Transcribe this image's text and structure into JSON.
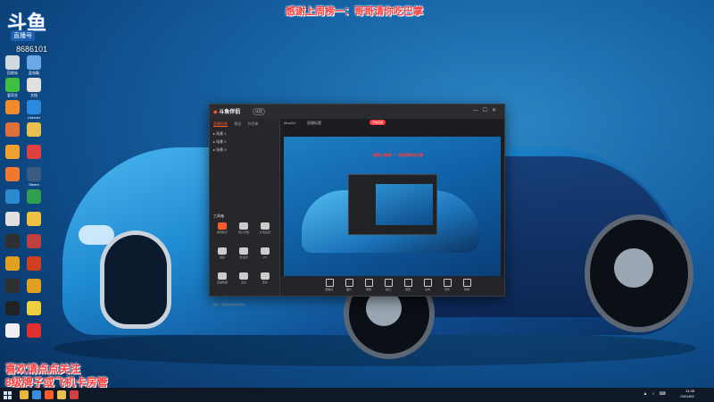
{
  "overlay": {
    "top_banner": "感谢上周榜一：哥哥请你吃巴掌",
    "bottom_line1": "喜欢请点点关注",
    "bottom_line2": "8级牌子或飞机卡房管",
    "logo_text": "斗鱼",
    "logo_sub": "直播号",
    "room_number": "8686101"
  },
  "desktop_icons": [
    {
      "name": "recycle-bin-icon",
      "label": "回收站",
      "color": "#d0d8e0"
    },
    {
      "name": "computer-icon",
      "label": "此电脑",
      "color": "#6aa8e8"
    },
    {
      "name": "iqiyi-icon",
      "label": "爱奇艺",
      "color": "#3fbf3f"
    },
    {
      "name": "doc-icon",
      "label": "文档",
      "color": "#e0e0e0"
    },
    {
      "name": "orange-app-icon",
      "label": "",
      "color": "#f08a2a"
    },
    {
      "name": "ie-icon",
      "label": "Internet",
      "color": "#2a8ae0"
    },
    {
      "name": "app-icon-2",
      "label": "",
      "color": "#e0703a"
    },
    {
      "name": "folder-icon",
      "label": "",
      "color": "#e8c050"
    },
    {
      "name": "app-icon-3",
      "label": "",
      "color": "#f0a030"
    },
    {
      "name": "chrome-icon",
      "label": "",
      "color": "#e04040"
    },
    {
      "name": "app-icon-4",
      "label": "",
      "color": "#f07830"
    },
    {
      "name": "steam-icon",
      "label": "Steam",
      "color": "#3a5a80"
    },
    {
      "name": "edge-icon",
      "label": "",
      "color": "#2a8ad0"
    },
    {
      "name": "app-icon-5",
      "label": "",
      "color": "#30a050"
    },
    {
      "name": "app-icon-6",
      "label": "",
      "color": "#e0e0e0"
    },
    {
      "name": "app-icon-7",
      "label": "",
      "color": "#f0c040"
    },
    {
      "name": "app-icon-8",
      "label": "",
      "color": "#303030"
    },
    {
      "name": "app-icon-9",
      "label": "",
      "color": "#c04040"
    },
    {
      "name": "app-icon-10",
      "label": "",
      "color": "#e0a020"
    },
    {
      "name": "app-icon-11",
      "label": "",
      "color": "#d04020"
    },
    {
      "name": "app-icon-12",
      "label": "",
      "color": "#303030"
    },
    {
      "name": "app-icon-13",
      "label": "",
      "color": "#e0a020"
    },
    {
      "name": "qq-icon",
      "label": "",
      "color": "#222222"
    },
    {
      "name": "app-icon-14",
      "label": "",
      "color": "#f0d040"
    },
    {
      "name": "file-icon",
      "label": "",
      "color": "#f0f0f0"
    },
    {
      "name": "app-icon-15",
      "label": "",
      "color": "#e03030"
    }
  ],
  "app": {
    "title": "斗鱼伴侣",
    "badge": "试用",
    "sidebar_tabs": [
      "直播场景",
      "预设",
      "节目单"
    ],
    "scenes": [
      "场景 1",
      "场景 2",
      "场景 3"
    ],
    "tools_label": "工具箱",
    "tools": [
      {
        "name": "tool-item-1",
        "label": "弹幕助手",
        "color": "#ff5a2a"
      },
      {
        "name": "tool-item-2",
        "label": "观众管理",
        "color": "#cccccc"
      },
      {
        "name": "tool-item-3",
        "label": "礼物设置",
        "color": "#cccccc"
      },
      {
        "name": "tool-item-4",
        "label": "抽奖",
        "color": "#cccccc"
      },
      {
        "name": "tool-item-5",
        "label": "粉丝团",
        "color": "#cccccc"
      },
      {
        "name": "tool-item-6",
        "label": "PK",
        "color": "#cccccc"
      },
      {
        "name": "tool-item-7",
        "label": "直播数据",
        "color": "#cccccc"
      },
      {
        "name": "tool-item-8",
        "label": "连麦",
        "color": "#cccccc"
      },
      {
        "name": "tool-item-9",
        "label": "更多",
        "color": "#cccccc"
      }
    ],
    "notice": "提示：直播中请勿关闭软件",
    "toolbar": {
      "room": "MuaZel",
      "title": "直播标题",
      "start_live": "开始直播"
    },
    "preview_text": "感谢上周榜一：哥哥请你吃巴掌",
    "bottom_buttons": [
      "摄像头",
      "图片",
      "屏幕",
      "窗口",
      "游戏",
      "文本",
      "音乐",
      "特效"
    ]
  },
  "taskbar": {
    "time": "11:38",
    "date": "2021/8/1",
    "icons": [
      {
        "name": "explorer-icon",
        "color": "#e8b840"
      },
      {
        "name": "browser-icon",
        "color": "#3a90e0"
      },
      {
        "name": "douyu-icon",
        "color": "#ff5a2a"
      },
      {
        "name": "folder-taskbar-icon",
        "color": "#e8c050"
      },
      {
        "name": "app-taskbar-icon",
        "color": "#d04040"
      }
    ]
  }
}
